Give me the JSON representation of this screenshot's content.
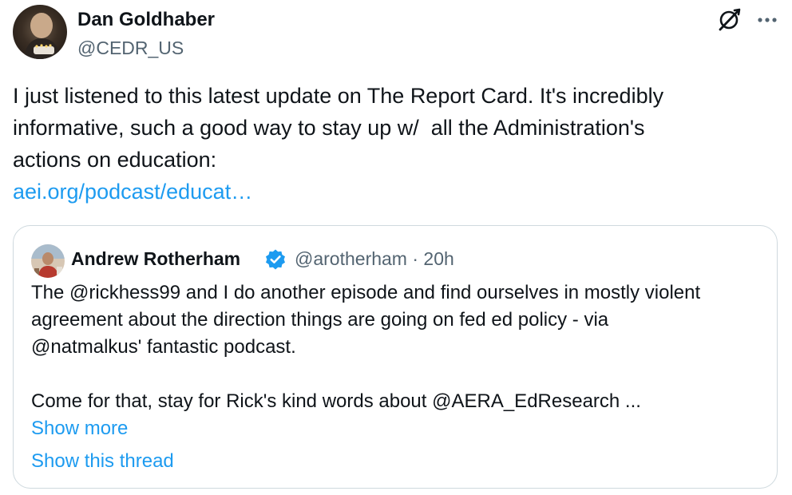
{
  "author": {
    "name": "Dan Goldhaber",
    "handle": "@CEDR_US",
    "avatar_icon": "profile-photo"
  },
  "actions": {
    "grok_icon": "grok-icon",
    "more_icon": "more-options-icon"
  },
  "tweet": {
    "text_lines": [
      "I just listened to this latest update on The Report Card. It's incredibly",
      "informative, such a good way to stay up w/  all the Administration's",
      "actions on education:"
    ],
    "link": "aei.org/podcast/educat…"
  },
  "quote": {
    "author_name": "Andrew Rotherham",
    "verified_icon": "verified-badge-icon",
    "handle": "@arotherham",
    "separator": "·",
    "time": "20h",
    "paragraph1_lines": [
      "The @rickhess99 and I do another episode and find ourselves in mostly violent",
      "agreement about the direction things are going on fed ed policy - via",
      "@natmalkus' fantastic podcast."
    ],
    "paragraph2_lines": [
      "Come for that, stay for Rick's kind words about @AERA_EdResearch ..."
    ],
    "show_more": "Show more",
    "show_thread": "Show this thread"
  },
  "colors": {
    "text": "#0f1419",
    "secondary": "#536471",
    "link": "#1d9bf0",
    "border": "#cfd9de"
  }
}
